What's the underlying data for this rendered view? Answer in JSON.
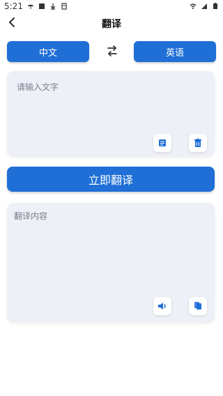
{
  "status": {
    "time": "5:21"
  },
  "header": {
    "title": "翻译"
  },
  "languages": {
    "source": "中文",
    "target": "英语"
  },
  "input": {
    "placeholder": "请输入文字"
  },
  "actions": {
    "translate_label": "立即翻译"
  },
  "output": {
    "placeholder": "翻译内容"
  },
  "icons": {
    "back": "chevron-left-icon",
    "swap": "swap-arrows-icon",
    "doc": "document-icon",
    "trash": "trash-icon",
    "speaker": "speaker-icon",
    "copy": "copy-icon"
  },
  "colors": {
    "primary": "#1F6FD6",
    "card_bg": "#EEF0F7"
  }
}
